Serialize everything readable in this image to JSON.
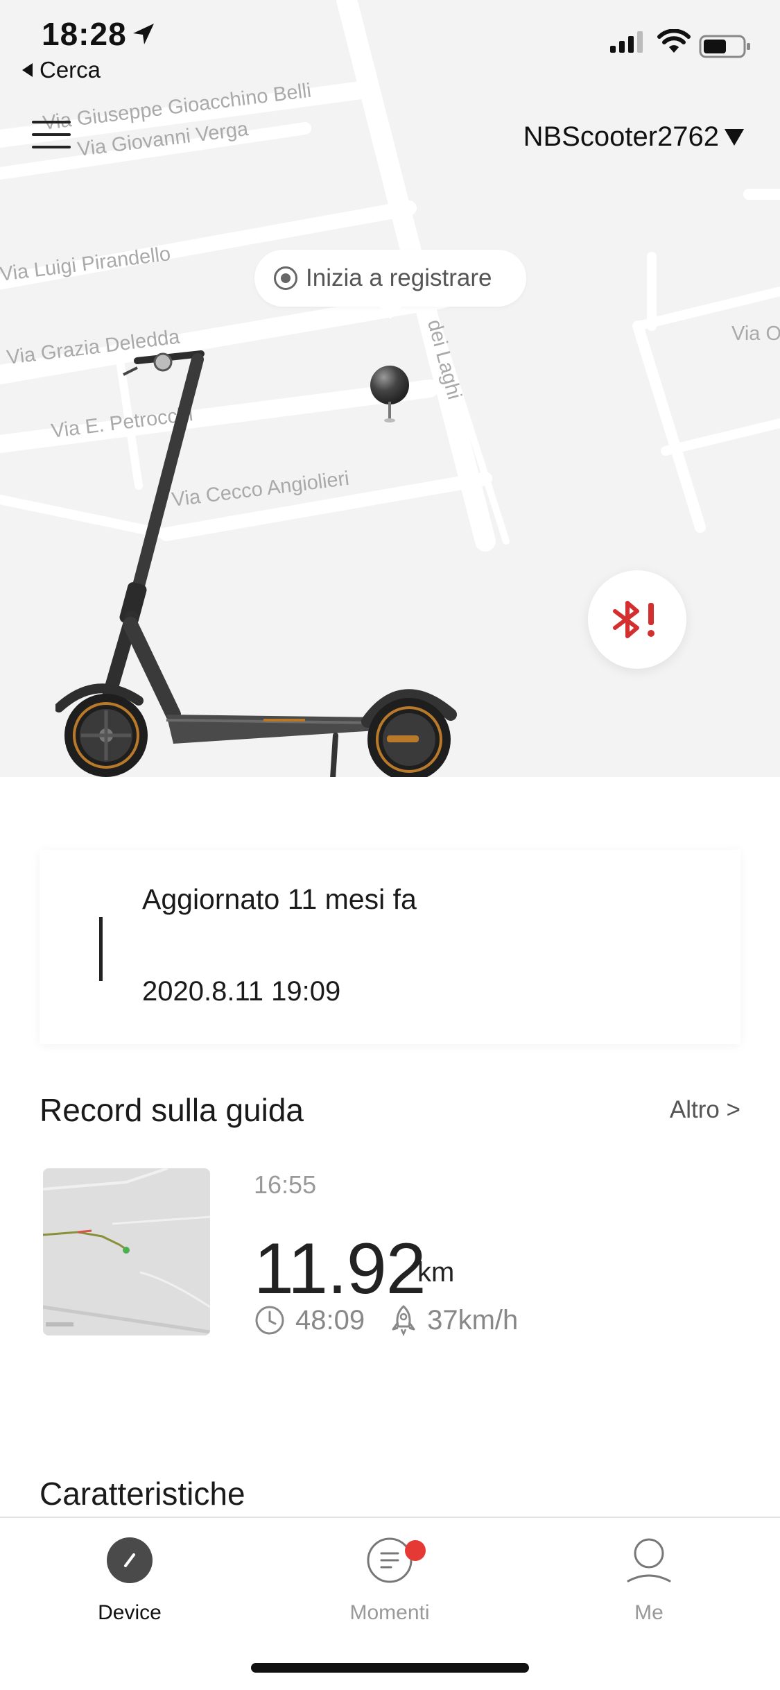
{
  "status_bar": {
    "time": "18:28",
    "back_label": "Cerca"
  },
  "header": {
    "device_name": "NBScooter2762"
  },
  "map": {
    "streets": [
      "Via Giuseppe Gioacchino Belli",
      "Via Giovanni Verga",
      "Via Luigi Pirandello",
      "Via Grazia Deledda",
      "Via E. Petrocchi",
      "Via Cecco Angiolieri",
      "dei Laghi",
      "Via O"
    ],
    "record_label": "Inizia a registrare"
  },
  "update_card": {
    "title": "Aggiornato 11 mesi fa",
    "datetime": "2020.8.11 19:09"
  },
  "ride_record": {
    "section_title": "Record sulla guida",
    "more_label": "Altro >",
    "start_time": "16:55",
    "distance": "11.92",
    "distance_unit": "km",
    "duration": "48:09",
    "top_speed": "37km/h"
  },
  "features": {
    "section_title": "Caratteristiche"
  },
  "tabs": [
    {
      "label": "Device",
      "icon": "device-icon",
      "active": true
    },
    {
      "label": "Momenti",
      "icon": "moments-icon",
      "active": false,
      "badge": true
    },
    {
      "label": "Me",
      "icon": "profile-icon",
      "active": false
    }
  ],
  "colors": {
    "accent_red": "#e53935",
    "bluetooth_warning": "#d32f2f",
    "text_primary": "#1a1a1a",
    "text_secondary": "#999999"
  }
}
